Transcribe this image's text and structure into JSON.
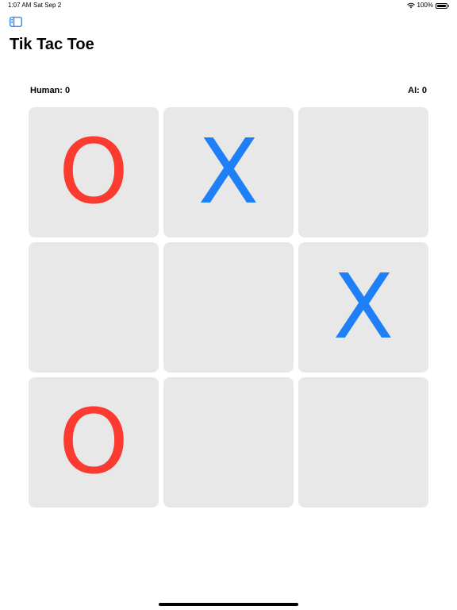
{
  "status_bar": {
    "time": "1:07 AM",
    "date": "Sat Sep 2",
    "battery": "100%",
    "battery_level": 1.0
  },
  "header": {
    "title": "Tik Tac Toe",
    "sidebar_icon": "sidebar-icon"
  },
  "scores": {
    "human": "Human: 0",
    "ai": "AI: 0"
  },
  "board": {
    "cells": [
      "O",
      "X",
      "",
      "",
      "",
      "X",
      "O",
      "",
      ""
    ]
  },
  "colors": {
    "accent": "#1e7ff7",
    "x_color": "#1e7ff7",
    "o_color": "#fb3b30",
    "cell_background": "#e8e8e8"
  }
}
